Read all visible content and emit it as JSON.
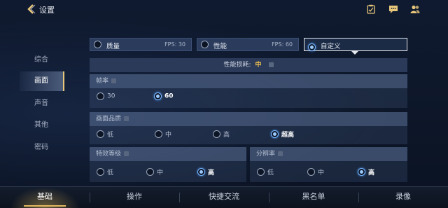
{
  "header": {
    "title": "设置"
  },
  "sidebar": {
    "items": [
      {
        "label": "综合"
      },
      {
        "label": "画面"
      },
      {
        "label": "声音"
      },
      {
        "label": "其他"
      },
      {
        "label": "密码"
      }
    ]
  },
  "presets": [
    {
      "label": "质量",
      "fps": "FPS: 30"
    },
    {
      "label": "性能",
      "fps": "FPS: 60"
    },
    {
      "label": "自定义",
      "fps": ""
    }
  ],
  "performance": {
    "label": "性能损耗:",
    "value": "中"
  },
  "framerate": {
    "title": "帧率",
    "options": [
      "30",
      "60"
    ],
    "selected": "60"
  },
  "quality": {
    "title": "画面品质",
    "options": [
      "低",
      "中",
      "高",
      "超高"
    ],
    "selected": "超高"
  },
  "effects": {
    "title": "特效等级",
    "options": [
      "低",
      "中",
      "高"
    ],
    "selected": "高"
  },
  "resolution": {
    "title": "分辨率",
    "options": [
      "低",
      "中",
      "高"
    ],
    "selected": "高"
  },
  "bottom_tabs": [
    {
      "label": "基础"
    },
    {
      "label": "操作"
    },
    {
      "label": "快捷交流"
    },
    {
      "label": "黑名单"
    },
    {
      "label": "录像"
    }
  ],
  "colors": {
    "accent": "#e3b961",
    "selected_radio": "#79b6ff",
    "highlight": "#f3c451"
  }
}
